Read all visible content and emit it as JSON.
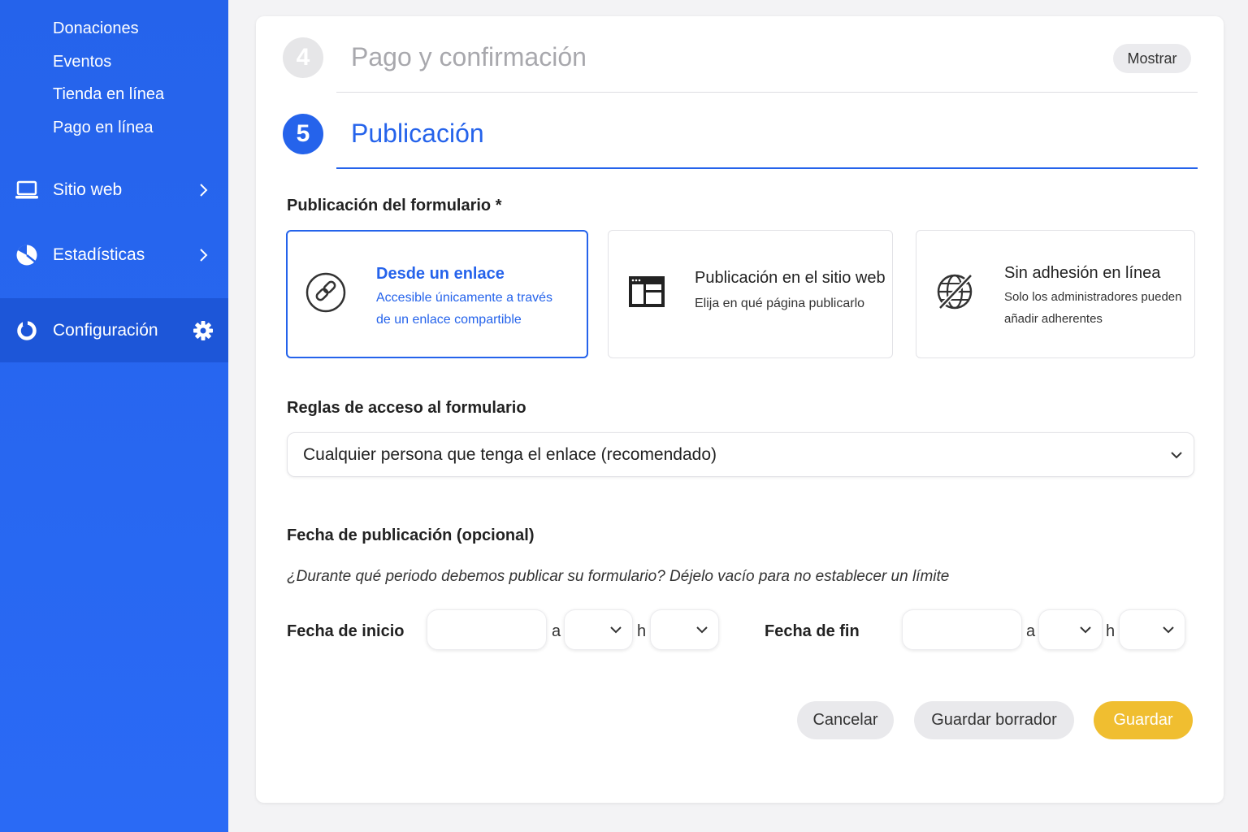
{
  "sidebar": {
    "sub_items": [
      "Donaciones",
      "Eventos",
      "Tienda en línea",
      "Pago en línea"
    ],
    "nav": [
      {
        "label": "Sitio web",
        "icon": "laptop-icon"
      },
      {
        "label": "Estadísticas",
        "icon": "chart-pie-icon"
      },
      {
        "label": "Configuración",
        "icon": "circle-icon",
        "active": true
      }
    ]
  },
  "steps": {
    "step4": {
      "number": "4",
      "title": "Pago y confirmación",
      "action": "Mostrar"
    },
    "step5": {
      "number": "5",
      "title": "Publicación"
    }
  },
  "publication": {
    "label": "Publicación del formulario *",
    "options": [
      {
        "title": "Desde un enlace",
        "desc1": "Accesible únicamente a través",
        "desc2": "de un enlace compartible",
        "icon": "link-icon",
        "selected": true
      },
      {
        "title": "Publicación en el sitio web",
        "desc1": "Elija en qué página publicarlo",
        "icon": "webpage-icon"
      },
      {
        "title": "Sin adhesión en línea",
        "desc1": "Solo los administradores pueden",
        "desc2": "añadir adherentes",
        "icon": "globe-off-icon"
      }
    ]
  },
  "access": {
    "label": "Reglas de acceso al formulario",
    "value": "Cualquier persona que tenga el enlace (recomendado)"
  },
  "date": {
    "label": "Fecha de publicación (opcional)",
    "hint": "¿Durante qué periodo debemos publicar su formulario? Déjelo vacío para no establecer un límite",
    "start_label": "Fecha de inicio",
    "end_label": "Fecha de fin",
    "at": "a",
    "hour": "h"
  },
  "actions": {
    "cancel": "Cancelar",
    "draft": "Guardar borrador",
    "save": "Guardar"
  },
  "colors": {
    "primary": "#2563eb",
    "sidebar": "#2563eb",
    "save": "#f0be30"
  }
}
